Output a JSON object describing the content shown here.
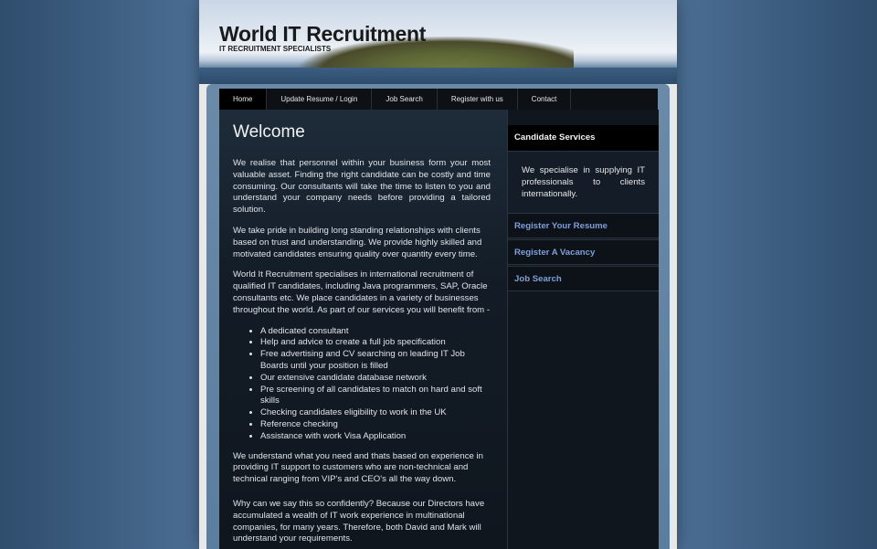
{
  "header": {
    "title": "World IT Recruitment",
    "subtitle": "IT RECRUITMENT SPECIALISTS"
  },
  "nav": [
    {
      "label": "Home"
    },
    {
      "label": "Update Resume / Login"
    },
    {
      "label": "Job Search"
    },
    {
      "label": "Register with us"
    },
    {
      "label": "Contact"
    }
  ],
  "main": {
    "heading": "Welcome",
    "p1": "We realise that personnel within your business form your most valuable asset. Finding the right candidate can be costly and time consuming. Our consultants will take the time to listen to you and understand your company needs before providing a tailored solution.",
    "p2": "We take pride in building long standing relationships with clients based on trust and understanding. We provide highly skilled and motivated candidates ensuring quality over quantity every time.",
    "p3": "World It Recruitment specialises in international recruitment of qualified IT candidates, including Java programmers, SAP, Oracle consultants etc. We place candidates in a variety of businesses throughout the world. As part of our services you will benefit from -",
    "list": [
      "A dedicated consultant",
      "Help and advice to create a full job specification",
      "Free advertising and CV searching on leading IT Job Boards until your position is filled",
      "Our extensive candidate database network",
      "Pre screening of all candidates to match on hard and soft skills",
      "Checking candidates eligibility to work in the UK",
      "Reference checking",
      "Assistance with work Visa Application"
    ],
    "p4": "We understand what you need and thats based on experience in providing IT support to customers who are non-technical and technical ranging from VIP's and CEO's all the way down.",
    "p5": "Why can we say this so confidently? Because our Directors have accumulated a wealth of IT work experience in multinational companies, for many years. Therefore, both David and Mark will understand your requirements."
  },
  "sidebar": {
    "heading": "Candidate Services",
    "text": "We specialise in supplying IT professionals to clients internationally.",
    "links": [
      {
        "label": "Register Your Resume"
      },
      {
        "label": "Register A Vacancy"
      },
      {
        "label": "Job Search"
      }
    ]
  }
}
